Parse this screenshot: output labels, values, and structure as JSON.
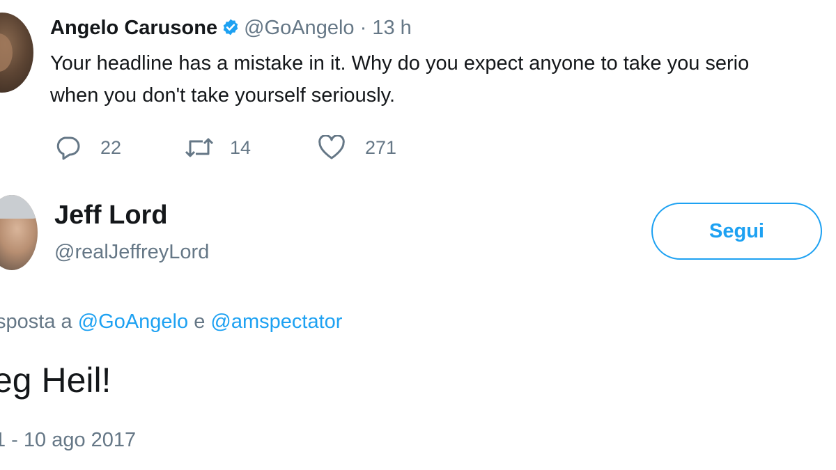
{
  "reply_tweet": {
    "author_name": "Angelo Carusone",
    "verified": true,
    "handle": "@GoAngelo",
    "separator": "·",
    "time": "13 h",
    "text_line1": "Your headline has a mistake in it. Why do you expect anyone to take you serio",
    "text_line2": "when you don't take yourself seriously.",
    "actions": {
      "reply_count": "22",
      "retweet_count": "14",
      "like_count": "271",
      "reply_icon": "reply-icon",
      "retweet_icon": "retweet-icon",
      "like_icon": "heart-icon"
    }
  },
  "main_tweet": {
    "author_name": "Jeff Lord",
    "handle": "@realJeffreyLord",
    "follow_label": "Segui",
    "reply_prefix": "sposta a",
    "reply_mention_1": "@GoAngelo",
    "reply_conjunction": "e",
    "reply_mention_2": "@amspectator",
    "text": "eg Heil!",
    "timestamp": "1 - 10 ago 2017"
  },
  "colors": {
    "accent": "#1da1f2",
    "secondary_text": "#657786",
    "primary_text": "#14171a",
    "background": "#ffffff"
  }
}
